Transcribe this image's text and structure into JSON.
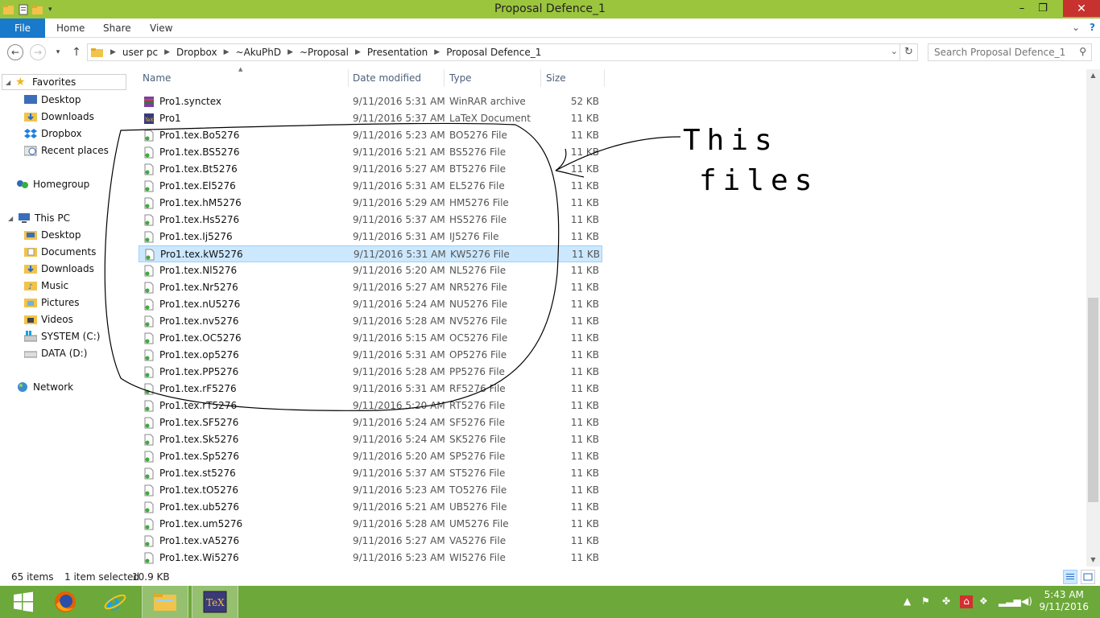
{
  "window": {
    "title": "Proposal Defence_1"
  },
  "ribbon": {
    "tabs": [
      "File",
      "Home",
      "Share",
      "View"
    ]
  },
  "address": {
    "crumbs": [
      "user pc",
      "Dropbox",
      "~AkuPhD",
      "~Proposal",
      "Presentation",
      "Proposal Defence_1"
    ]
  },
  "search": {
    "placeholder": "Search Proposal Defence_1"
  },
  "nav": {
    "favorites": "Favorites",
    "fav_items": [
      "Desktop",
      "Downloads",
      "Dropbox",
      "Recent places"
    ],
    "homegroup": "Homegroup",
    "thispc": "This PC",
    "pc_items": [
      "Desktop",
      "Documents",
      "Downloads",
      "Music",
      "Pictures",
      "Videos",
      "SYSTEM (C:)",
      "DATA (D:)"
    ],
    "network": "Network"
  },
  "columns": {
    "name": "Name",
    "date": "Date modified",
    "type": "Type",
    "size": "Size"
  },
  "files": [
    {
      "name": "Pro1.synctex",
      "date": "9/11/2016 5:31 AM",
      "type": "WinRAR archive",
      "size": "52 KB",
      "icon": "winrar-icon"
    },
    {
      "name": "Pro1",
      "date": "9/11/2016 5:37 AM",
      "type": "LaTeX Document",
      "size": "11 KB",
      "icon": "latex-icon"
    },
    {
      "name": "Pro1.tex.Bo5276",
      "date": "9/11/2016 5:23 AM",
      "type": "BO5276 File",
      "size": "11 KB",
      "icon": "file-icon"
    },
    {
      "name": "Pro1.tex.BS5276",
      "date": "9/11/2016 5:21 AM",
      "type": "BS5276 File",
      "size": "11 KB",
      "icon": "file-icon"
    },
    {
      "name": "Pro1.tex.Bt5276",
      "date": "9/11/2016 5:27 AM",
      "type": "BT5276 File",
      "size": "11 KB",
      "icon": "file-icon"
    },
    {
      "name": "Pro1.tex.El5276",
      "date": "9/11/2016 5:31 AM",
      "type": "EL5276 File",
      "size": "11 KB",
      "icon": "file-icon"
    },
    {
      "name": "Pro1.tex.hM5276",
      "date": "9/11/2016 5:29 AM",
      "type": "HM5276 File",
      "size": "11 KB",
      "icon": "file-icon"
    },
    {
      "name": "Pro1.tex.Hs5276",
      "date": "9/11/2016 5:37 AM",
      "type": "HS5276 File",
      "size": "11 KB",
      "icon": "file-icon"
    },
    {
      "name": "Pro1.tex.Ij5276",
      "date": "9/11/2016 5:31 AM",
      "type": "IJ5276 File",
      "size": "11 KB",
      "icon": "file-icon"
    },
    {
      "name": "Pro1.tex.kW5276",
      "date": "9/11/2016 5:31 AM",
      "type": "KW5276 File",
      "size": "11 KB",
      "icon": "file-icon",
      "selected": true
    },
    {
      "name": "Pro1.tex.Nl5276",
      "date": "9/11/2016 5:20 AM",
      "type": "NL5276 File",
      "size": "11 KB",
      "icon": "file-icon"
    },
    {
      "name": "Pro1.tex.Nr5276",
      "date": "9/11/2016 5:27 AM",
      "type": "NR5276 File",
      "size": "11 KB",
      "icon": "file-icon"
    },
    {
      "name": "Pro1.tex.nU5276",
      "date": "9/11/2016 5:24 AM",
      "type": "NU5276 File",
      "size": "11 KB",
      "icon": "file-icon"
    },
    {
      "name": "Pro1.tex.nv5276",
      "date": "9/11/2016 5:28 AM",
      "type": "NV5276 File",
      "size": "11 KB",
      "icon": "file-icon"
    },
    {
      "name": "Pro1.tex.OC5276",
      "date": "9/11/2016 5:15 AM",
      "type": "OC5276 File",
      "size": "11 KB",
      "icon": "file-icon"
    },
    {
      "name": "Pro1.tex.op5276",
      "date": "9/11/2016 5:31 AM",
      "type": "OP5276 File",
      "size": "11 KB",
      "icon": "file-icon"
    },
    {
      "name": "Pro1.tex.PP5276",
      "date": "9/11/2016 5:28 AM",
      "type": "PP5276 File",
      "size": "11 KB",
      "icon": "file-icon"
    },
    {
      "name": "Pro1.tex.rF5276",
      "date": "9/11/2016 5:31 AM",
      "type": "RF5276 File",
      "size": "11 KB",
      "icon": "file-icon"
    },
    {
      "name": "Pro1.tex.rT5276",
      "date": "9/11/2016 5:20 AM",
      "type": "RT5276 File",
      "size": "11 KB",
      "icon": "file-icon"
    },
    {
      "name": "Pro1.tex.SF5276",
      "date": "9/11/2016 5:24 AM",
      "type": "SF5276 File",
      "size": "11 KB",
      "icon": "file-icon"
    },
    {
      "name": "Pro1.tex.Sk5276",
      "date": "9/11/2016 5:24 AM",
      "type": "SK5276 File",
      "size": "11 KB",
      "icon": "file-icon"
    },
    {
      "name": "Pro1.tex.Sp5276",
      "date": "9/11/2016 5:20 AM",
      "type": "SP5276 File",
      "size": "11 KB",
      "icon": "file-icon"
    },
    {
      "name": "Pro1.tex.st5276",
      "date": "9/11/2016 5:37 AM",
      "type": "ST5276 File",
      "size": "11 KB",
      "icon": "file-icon"
    },
    {
      "name": "Pro1.tex.tO5276",
      "date": "9/11/2016 5:23 AM",
      "type": "TO5276 File",
      "size": "11 KB",
      "icon": "file-icon"
    },
    {
      "name": "Pro1.tex.ub5276",
      "date": "9/11/2016 5:21 AM",
      "type": "UB5276 File",
      "size": "11 KB",
      "icon": "file-icon"
    },
    {
      "name": "Pro1.tex.um5276",
      "date": "9/11/2016 5:28 AM",
      "type": "UM5276 File",
      "size": "11 KB",
      "icon": "file-icon"
    },
    {
      "name": "Pro1.tex.vA5276",
      "date": "9/11/2016 5:27 AM",
      "type": "VA5276 File",
      "size": "11 KB",
      "icon": "file-icon"
    },
    {
      "name": "Pro1.tex.Wi5276",
      "date": "9/11/2016 5:23 AM",
      "type": "WI5276 File",
      "size": "11 KB",
      "icon": "file-icon"
    }
  ],
  "status": {
    "items": "65 items",
    "selected": "1 item selected",
    "size": "10.9 KB"
  },
  "annotation": {
    "line1": "This",
    "line2": "files"
  },
  "taskbar": {
    "apps": [
      "windows-start-icon",
      "firefox-icon",
      "internet-explorer-icon",
      "file-explorer-icon",
      "texstudio-icon"
    ],
    "time": "5:43 AM",
    "date": "9/11/2016"
  },
  "colors": {
    "titlebar": "#9bc53d",
    "taskbar": "#6da83a",
    "selection": "#cce8ff",
    "file_tab": "#1979ca"
  }
}
